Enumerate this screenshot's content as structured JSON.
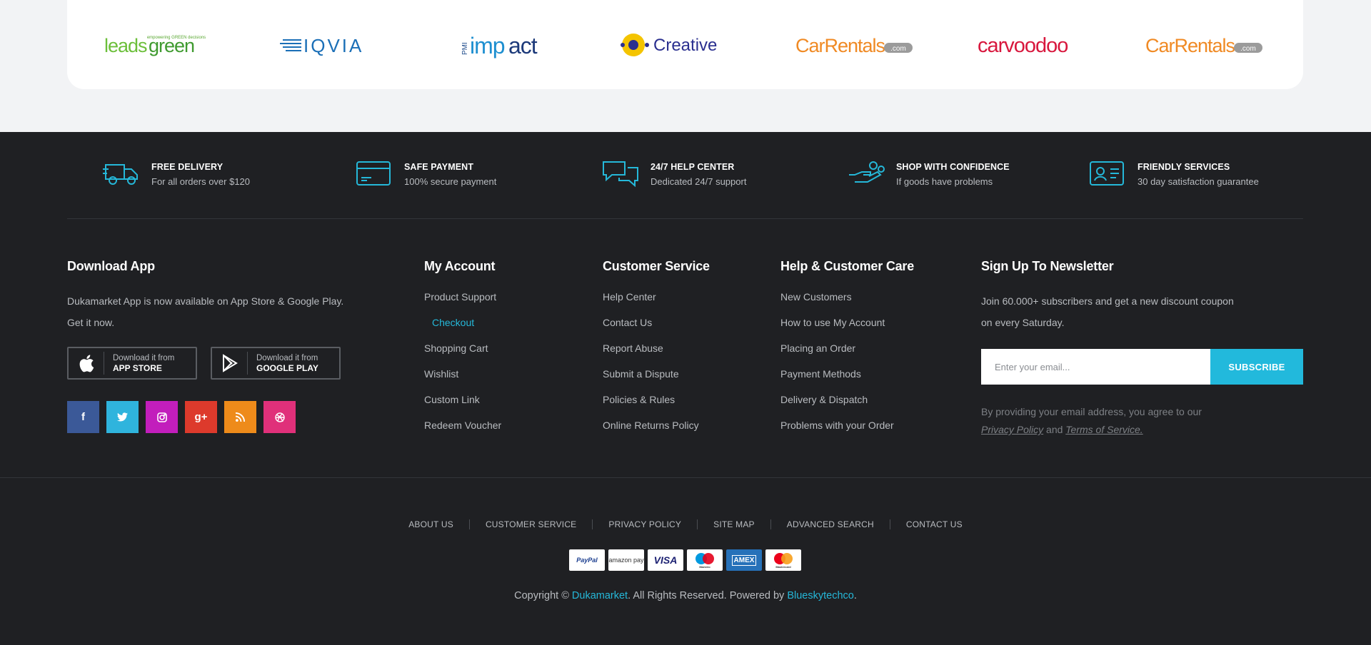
{
  "brands": [
    {
      "name": "leadsgreen",
      "tagline": "empowering GREEN decisions"
    },
    {
      "name": "IQVIA"
    },
    {
      "name": "impact",
      "prefix": "PMI"
    },
    {
      "name": "Creative"
    },
    {
      "name": "CarRentals",
      "suffix": ".com"
    },
    {
      "name": "carvoodoo"
    },
    {
      "name": "CarRentals",
      "suffix": ".com"
    }
  ],
  "features": [
    {
      "title": "FREE DELIVERY",
      "subtitle": "For all orders over $120",
      "icon": "truck-icon"
    },
    {
      "title": "SAFE PAYMENT",
      "subtitle": "100% secure payment",
      "icon": "credit-card-icon"
    },
    {
      "title": "24/7 HELP CENTER",
      "subtitle": "Dedicated 24/7 support",
      "icon": "chat-bubbles-icon"
    },
    {
      "title": "SHOP WITH CONFIDENCE",
      "subtitle": "If goods have problems",
      "icon": "hand-money-icon"
    },
    {
      "title": "FRIENDLY SERVICES",
      "subtitle": "30 day satisfaction guarantee",
      "icon": "id-card-icon"
    }
  ],
  "download_app": {
    "title": "Download App",
    "text_line1": "Dukamarket App is now available on App Store & Google Play.",
    "text_line2": "Get it now.",
    "app_store": {
      "small": "Download it from",
      "big": "APP STORE"
    },
    "google_play": {
      "small": "Download it from",
      "big": "GOOGLE PLAY"
    }
  },
  "social": [
    {
      "name": "facebook",
      "glyph": "f",
      "color": "#3b5998"
    },
    {
      "name": "twitter",
      "glyph": "t",
      "color": "#2fb4dd"
    },
    {
      "name": "instagram",
      "glyph": "◎",
      "color": "#c21ebc"
    },
    {
      "name": "google-plus",
      "glyph": "g+",
      "color": "#dd3a2c"
    },
    {
      "name": "rss",
      "glyph": "rss",
      "color": "#ee8b1a"
    },
    {
      "name": "dribbble",
      "glyph": "◍",
      "color": "#e0307a"
    }
  ],
  "my_account": {
    "title": "My Account",
    "links": [
      "Product Support",
      "Checkout",
      "Shopping Cart",
      "Wishlist",
      "Custom Link",
      "Redeem Voucher"
    ]
  },
  "customer_service": {
    "title": "Customer Service",
    "links": [
      "Help Center",
      "Contact Us",
      "Report Abuse",
      "Submit a Dispute",
      "Policies & Rules",
      "Online Returns Policy"
    ]
  },
  "help_care": {
    "title": "Help & Customer Care",
    "links": [
      "New Customers",
      "How to use My Account",
      "Placing an Order",
      "Payment Methods",
      "Delivery & Dispatch",
      "Problems with your Order"
    ]
  },
  "newsletter": {
    "title": "Sign Up To Newsletter",
    "text_line1": "Join 60.000+ subscribers and get a new discount coupon",
    "text_line2": "on every Saturday.",
    "placeholder": "Enter your email...",
    "button": "SUBSCRIBE",
    "note_line1": "By providing your email address, you agree to our",
    "privacy": "Privacy Policy",
    "and": "and",
    "terms": "Terms of Service."
  },
  "bottom_links": [
    "ABOUT US",
    "CUSTOMER SERVICE",
    "PRIVACY POLICY",
    "SITE MAP",
    "ADVANCED SEARCH",
    "CONTACT US"
  ],
  "payments": [
    "PayPal",
    "amazon pay",
    "VISA",
    "Maestro",
    "AMEX",
    "Mastercard"
  ],
  "copyright": {
    "prefix": "Copyright ©",
    "brand": "Dukamarket",
    "middle": ". All Rights Reserved. Powered by",
    "powered": "Blueskytechco",
    "suffix": "."
  },
  "colors": {
    "accent": "#22b9dc",
    "footer_bg": "#1f2023",
    "page_bg": "#f2f3f5"
  }
}
